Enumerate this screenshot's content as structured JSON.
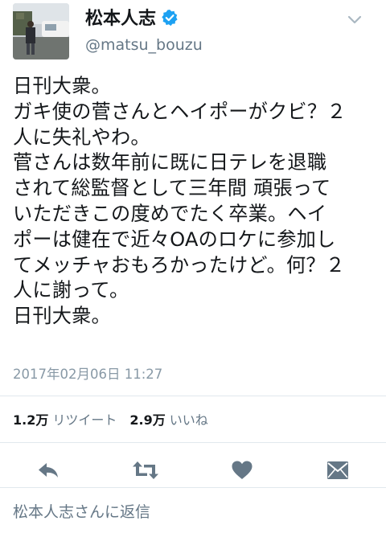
{
  "profile": {
    "display_name": "松本人志",
    "handle": "@matsu_bouzu",
    "verified": true
  },
  "tweet": {
    "lines": [
      "日刊大衆。",
      "ガキ使の菅さんとヘイポーがクビ？２",
      "人に失礼やわ。",
      "菅さんは数年前に既に日テレを退職",
      "されて総監督として三年間 頑張って",
      "いただきこの度めでたく卒業。ヘイ",
      "ポーは健在で近々OAのロケに参加し",
      "てメッチャおもろかったけど。何？２",
      "人に謝って。",
      "日刊大衆。"
    ],
    "timestamp": "2017年02月06日 11:27"
  },
  "stats": {
    "retweets_count": "1.2万",
    "retweets_label": "リツイート",
    "likes_count": "2.9万",
    "likes_label": "いいね"
  },
  "actions": {
    "icons": [
      "reply-icon",
      "retweet-icon",
      "like-icon",
      "direct-message-icon"
    ]
  },
  "reply": {
    "placeholder": "松本人志さんに返信"
  },
  "colors": {
    "text": "#14171a",
    "secondary": "#657786",
    "timestamp": "#8899a6",
    "icon": "#657786",
    "verified_badge": "#1da1f2",
    "divider": "#e1e8ed"
  }
}
